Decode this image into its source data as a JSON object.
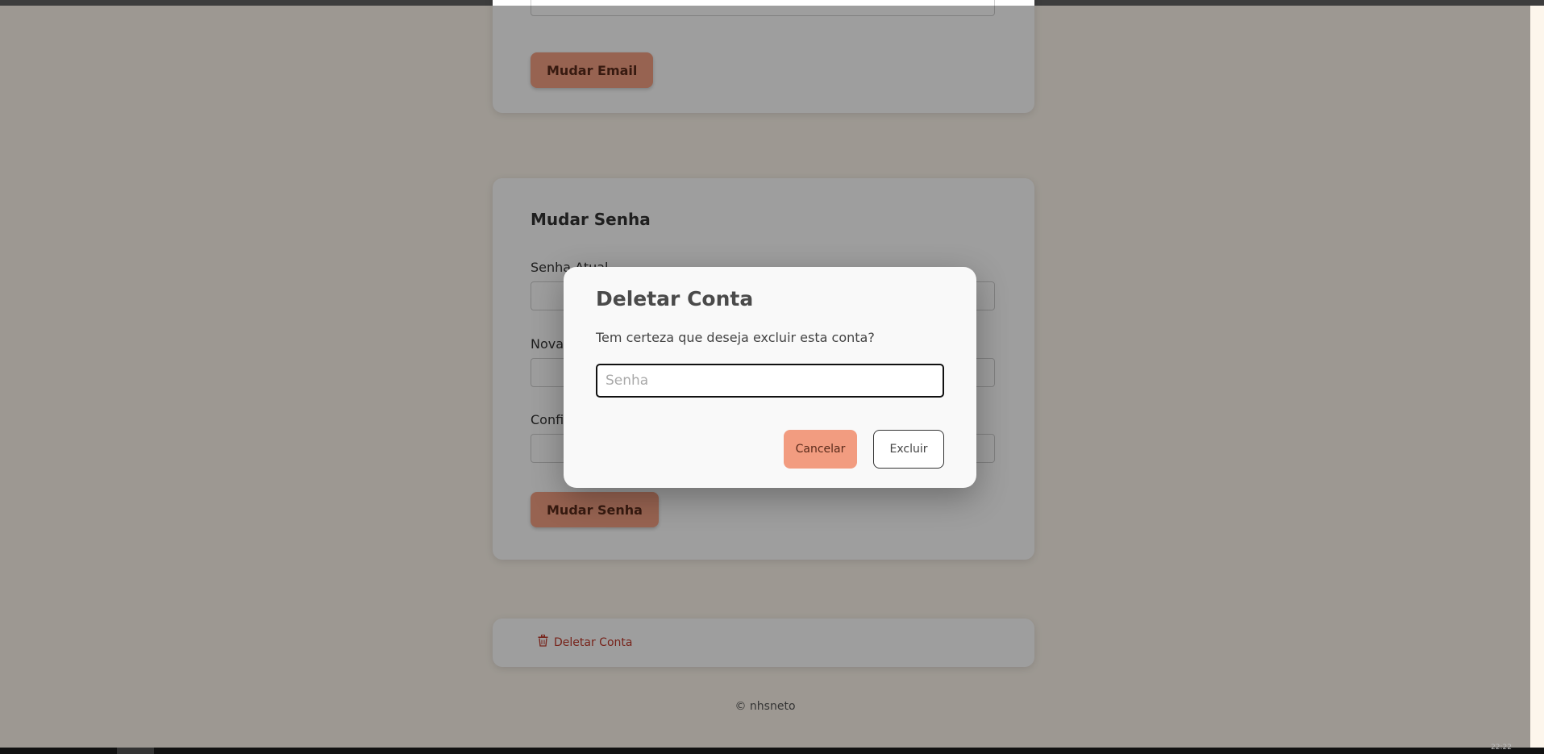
{
  "email_card": {
    "button_label": "Mudar Email"
  },
  "password_card": {
    "title": "Mudar Senha",
    "current_password_label": "Senha Atual",
    "new_password_label": "Nova",
    "confirm_password_label": "Confi",
    "button_label": "Mudar Senha"
  },
  "delete_card": {
    "link_label": "Deletar Conta",
    "icon": "trash-icon"
  },
  "footer": {
    "text": "© nhsneto"
  },
  "modal": {
    "title": "Deletar Conta",
    "message": "Tem certeza que deseja excluir esta conta?",
    "password_placeholder": "Senha",
    "password_value": "",
    "cancel_label": "Cancelar",
    "confirm_label": "Excluir"
  },
  "taskbar": {
    "clock": "22:22"
  },
  "colors": {
    "accent": "#f29c80",
    "danger": "#c0392b",
    "background": "#fdf6ec"
  }
}
